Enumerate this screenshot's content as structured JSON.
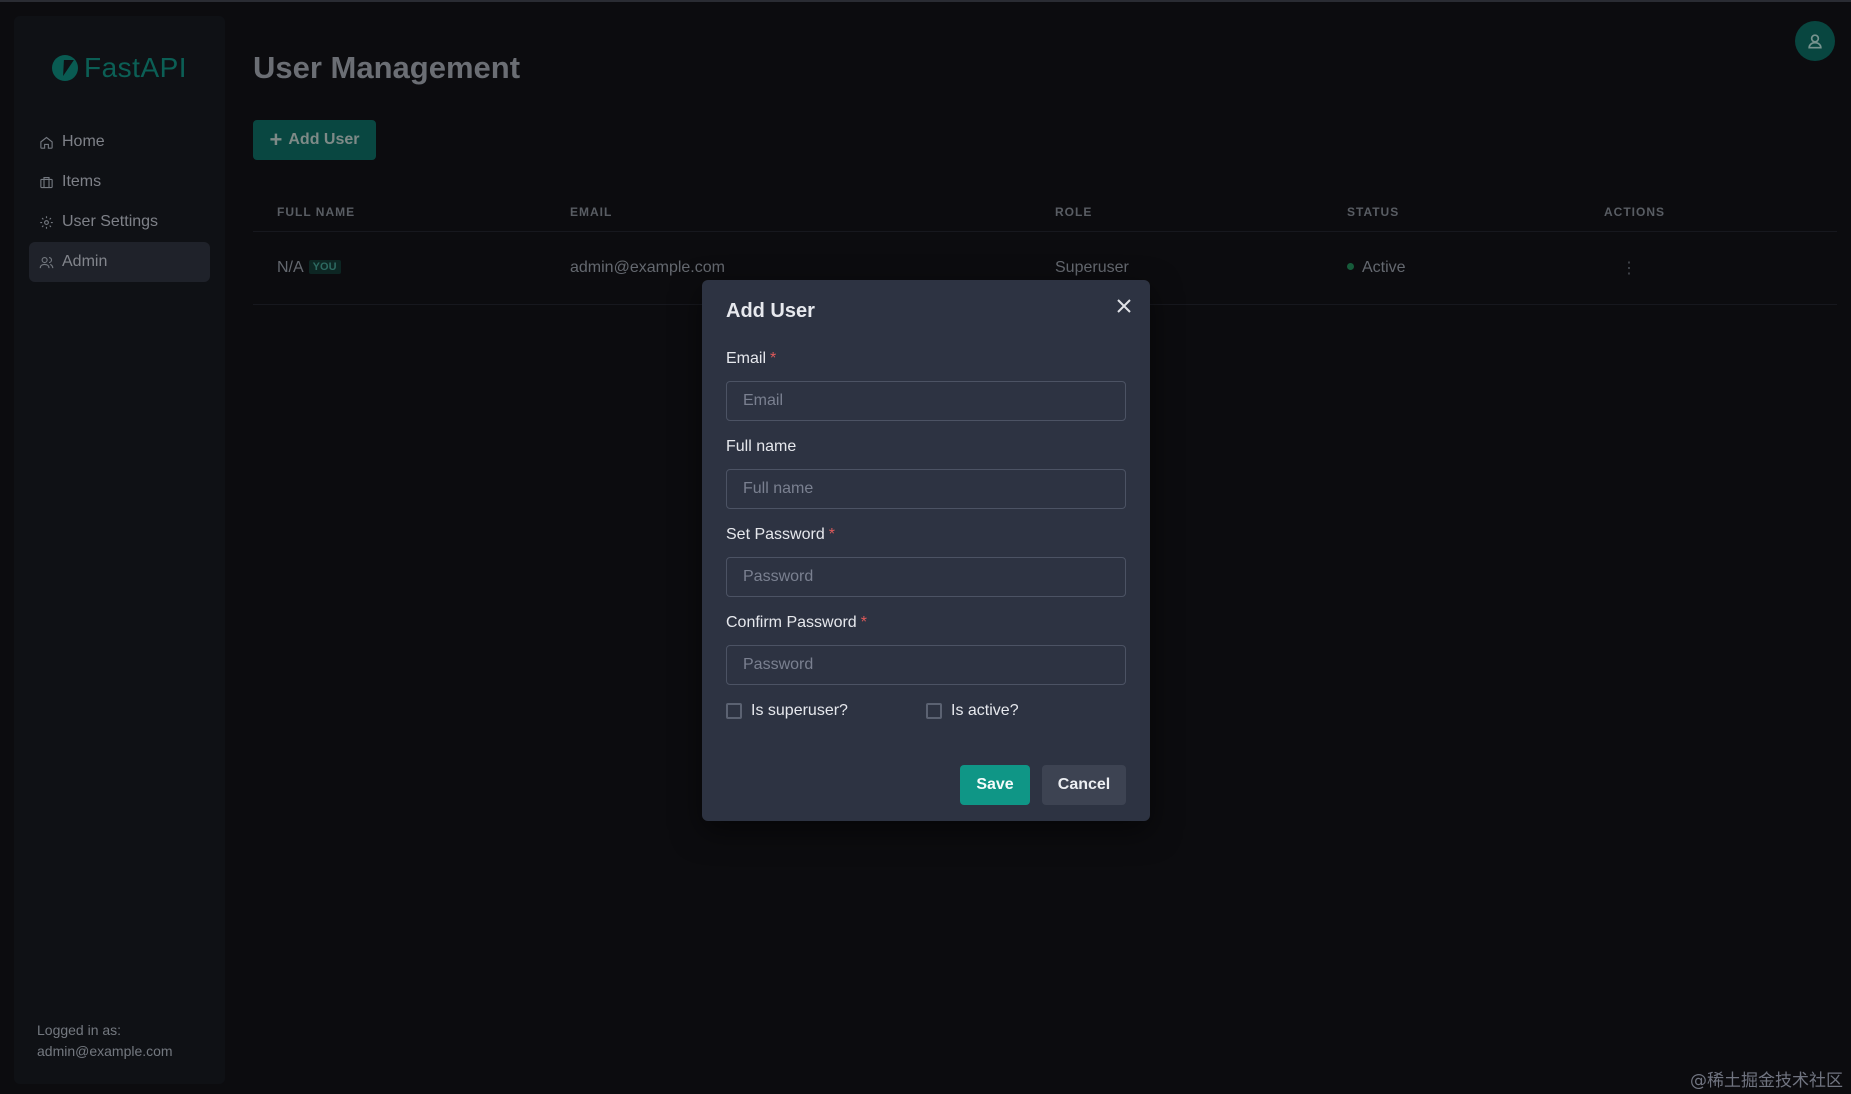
{
  "brand": {
    "name": "FastAPI"
  },
  "sidebar": {
    "items": [
      {
        "label": "Home",
        "icon": "home-icon"
      },
      {
        "label": "Items",
        "icon": "briefcase-icon"
      },
      {
        "label": "User Settings",
        "icon": "gear-icon"
      },
      {
        "label": "Admin",
        "icon": "users-icon",
        "active": true
      }
    ],
    "logged_in_label": "Logged in as:",
    "logged_in_email": "admin@example.com"
  },
  "main": {
    "title": "User Management",
    "add_button_label": "Add User",
    "table": {
      "headers": [
        "FULL NAME",
        "EMAIL",
        "ROLE",
        "STATUS",
        "ACTIONS"
      ],
      "rows": [
        {
          "full_name": "N/A",
          "badge": "YOU",
          "email": "admin@example.com",
          "role": "Superuser",
          "status": "Active",
          "actions": "⋮"
        }
      ]
    }
  },
  "modal": {
    "title": "Add User",
    "fields": [
      {
        "label": "Email",
        "required": true,
        "placeholder": "Email",
        "value": ""
      },
      {
        "label": "Full name",
        "required": false,
        "placeholder": "Full name",
        "value": ""
      },
      {
        "label": "Set Password",
        "required": true,
        "placeholder": "Password",
        "value": ""
      },
      {
        "label": "Confirm Password",
        "required": true,
        "placeholder": "Password",
        "value": ""
      }
    ],
    "checkboxes": [
      {
        "label": "Is superuser?",
        "checked": false
      },
      {
        "label": "Is active?",
        "checked": false
      }
    ],
    "save_label": "Save",
    "cancel_label": "Cancel"
  },
  "watermark": "@稀土掘金技术社区",
  "colors": {
    "accent": "#0f9686",
    "brand": "#0f7f72",
    "status_active": "#1e7a4e",
    "required": "#e05a5a"
  }
}
